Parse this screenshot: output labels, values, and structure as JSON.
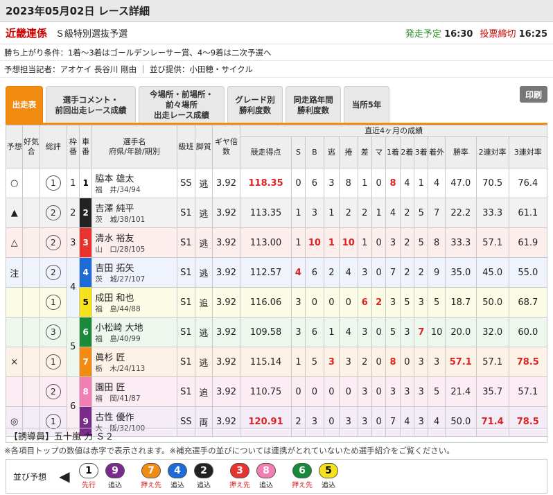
{
  "header": {
    "title": "2023年05月02日 レース詳細"
  },
  "race": {
    "name": "近畿連係",
    "sub": "Ｓ級特別選抜予選",
    "start_label": "発走予定",
    "start_time": "16:30",
    "close_label": "投票締切",
    "close_time": "16:25"
  },
  "info": {
    "condition": "勝ち上がり条件：1着～3着はゴールデンレーサー賞、4～9着は二次予選へ",
    "reporter": "予想担当記者：アオケイ 長谷川 剛由 ｜ 並び提供：小田穂・サイクル"
  },
  "tabs": [
    {
      "label": "出走表"
    },
    {
      "label": "選手コメント・\n前回出走レース成績"
    },
    {
      "label": "今場所・前場所・\n前々場所\n出走レース成績"
    },
    {
      "label": "グレード別\n勝利度数"
    },
    {
      "label": "同走路年間\n勝利度数"
    },
    {
      "label": "当所5年"
    }
  ],
  "print_label": "印刷",
  "table": {
    "group_header": "直近4ヶ月の成績",
    "columns": [
      "予想",
      "好気合",
      "総評",
      "枠番",
      "車番",
      "選手名\n府県/年齢/期別",
      "級班",
      "脚質",
      "ギヤ倍数",
      "競走得点",
      "S",
      "B",
      "逃",
      "捲",
      "差",
      "マ",
      "1着",
      "2着",
      "3着",
      "着外",
      "勝率",
      "2連対率",
      "3連対率"
    ],
    "rows": [
      {
        "mark": "○",
        "hyo": "1",
        "waku": "1",
        "car": "1",
        "name": "脇本 雄太",
        "profile": "福　井/34/94",
        "cls": "SS",
        "style": "逃",
        "gear": "3.92",
        "score": "118.35",
        "s": "0",
        "b": "6",
        "nige": "3",
        "makuri": "8",
        "sashi": "1",
        "ma": "0",
        "c1": "8",
        "c2": "4",
        "c3": "1",
        "out": "4",
        "win": "47.0",
        "ren2": "70.5",
        "ren3": "76.4"
      },
      {
        "mark": "▲",
        "hyo": "2",
        "waku": "2",
        "car": "2",
        "name": "吉澤 純平",
        "profile": "茨　城/38/101",
        "cls": "S1",
        "style": "逃",
        "gear": "3.92",
        "score": "113.35",
        "s": "1",
        "b": "3",
        "nige": "1",
        "makuri": "2",
        "sashi": "2",
        "ma": "1",
        "c1": "4",
        "c2": "2",
        "c3": "5",
        "out": "7",
        "win": "22.2",
        "ren2": "33.3",
        "ren3": "61.1"
      },
      {
        "mark": "△",
        "hyo": "2",
        "waku": "3",
        "car": "3",
        "name": "清水 裕友",
        "profile": "山　口/28/105",
        "cls": "S1",
        "style": "逃",
        "gear": "3.92",
        "score": "113.00",
        "s": "1",
        "b": "10",
        "nige": "1",
        "makuri": "10",
        "sashi": "1",
        "ma": "0",
        "c1": "3",
        "c2": "2",
        "c3": "5",
        "out": "8",
        "win": "33.3",
        "ren2": "57.1",
        "ren3": "61.9"
      },
      {
        "mark": "注",
        "hyo": "2",
        "waku": "4",
        "car": "4",
        "name": "吉田 拓矢",
        "profile": "茨　城/27/107",
        "cls": "S1",
        "style": "逃",
        "gear": "3.92",
        "score": "112.57",
        "s": "4",
        "b": "6",
        "nige": "2",
        "makuri": "4",
        "sashi": "3",
        "ma": "0",
        "c1": "7",
        "c2": "2",
        "c3": "2",
        "out": "9",
        "win": "35.0",
        "ren2": "45.0",
        "ren3": "55.0"
      },
      {
        "mark": "",
        "hyo": "1",
        "waku": "",
        "car": "5",
        "name": "成田 和也",
        "profile": "福　島/44/88",
        "cls": "S1",
        "style": "追",
        "gear": "3.92",
        "score": "116.06",
        "s": "3",
        "b": "0",
        "nige": "0",
        "makuri": "0",
        "sashi": "6",
        "ma": "2",
        "c1": "3",
        "c2": "5",
        "c3": "3",
        "out": "5",
        "win": "18.7",
        "ren2": "50.0",
        "ren3": "68.7"
      },
      {
        "mark": "",
        "hyo": "3",
        "waku": "5",
        "car": "6",
        "name": "小松崎 大地",
        "profile": "福　島/40/99",
        "cls": "S1",
        "style": "逃",
        "gear": "3.92",
        "score": "109.58",
        "s": "3",
        "b": "6",
        "nige": "1",
        "makuri": "4",
        "sashi": "3",
        "ma": "0",
        "c1": "5",
        "c2": "3",
        "c3": "7",
        "out": "10",
        "win": "20.0",
        "ren2": "32.0",
        "ren3": "60.0"
      },
      {
        "mark": "×",
        "hyo": "1",
        "waku": "",
        "car": "7",
        "name": "眞杉 匠",
        "profile": "栃　木/24/113",
        "cls": "S1",
        "style": "逃",
        "gear": "3.92",
        "score": "115.14",
        "s": "1",
        "b": "5",
        "nige": "3",
        "makuri": "3",
        "sashi": "2",
        "ma": "0",
        "c1": "8",
        "c2": "0",
        "c3": "3",
        "out": "3",
        "win": "57.1",
        "ren2": "57.1",
        "ren3": "78.5"
      },
      {
        "mark": "",
        "hyo": "2",
        "waku": "6",
        "car": "8",
        "name": "園田 匠",
        "profile": "福　岡/41/87",
        "cls": "S1",
        "style": "追",
        "gear": "3.92",
        "score": "110.75",
        "s": "0",
        "b": "0",
        "nige": "0",
        "makuri": "0",
        "sashi": "3",
        "ma": "0",
        "c1": "3",
        "c2": "3",
        "c3": "3",
        "out": "5",
        "win": "21.4",
        "ren2": "35.7",
        "ren3": "57.1"
      },
      {
        "mark": "◎",
        "hyo": "1",
        "waku": "",
        "car": "9",
        "name": "古性 優作",
        "profile": "大　阪/32/100",
        "cls": "SS",
        "style": "両",
        "gear": "3.92",
        "score": "120.91",
        "s": "2",
        "b": "3",
        "nige": "0",
        "makuri": "3",
        "sashi": "3",
        "ma": "0",
        "c1": "7",
        "c2": "4",
        "c3": "3",
        "out": "4",
        "win": "50.0",
        "ren2": "71.4",
        "ren3": "78.5"
      }
    ]
  },
  "guide": "【誘導員】五十嵐 力 Ｓ２",
  "note": "※各項目トップの数値は赤字で表示されます。※補充選手の並びについては連携がとれていないため選手紹介をご覧ください。",
  "nara": {
    "label": "並び予想",
    "groups": [
      [
        {
          "num": "1",
          "tag": "先行"
        },
        {
          "num": "9",
          "tag": "追込"
        }
      ],
      [
        {
          "num": "7",
          "tag": "押え先"
        },
        {
          "num": "4",
          "tag": "追込"
        },
        {
          "num": "2",
          "tag": "追込"
        }
      ],
      [
        {
          "num": "3",
          "tag": "押え先"
        },
        {
          "num": "8",
          "tag": "追込"
        }
      ],
      [
        {
          "num": "6",
          "tag": "押え先"
        },
        {
          "num": "5",
          "tag": "追込"
        }
      ]
    ]
  },
  "colors": {
    "car": {
      "1": [
        "#ffffff",
        "#000"
      ],
      "2": [
        "#222222",
        "#fff"
      ],
      "3": [
        "#e8332e",
        "#fff"
      ],
      "4": [
        "#1d6bd6",
        "#fff"
      ],
      "5": [
        "#f5e21a",
        "#000"
      ],
      "6": [
        "#1a8a3a",
        "#fff"
      ],
      "7": [
        "#f18b12",
        "#fff"
      ],
      "8": [
        "#f27fb3",
        "#fff"
      ],
      "9": [
        "#7a2a8a",
        "#fff"
      ]
    },
    "row_bg": {
      "1": "#ffffff",
      "2": "#f2f2f2",
      "3": "#fdeeee",
      "4": "#eef3fc",
      "5": "#fcfbe6",
      "6": "#eef7ee",
      "7": "#fdf2e6",
      "8": "#fcecf4",
      "9": "#f4ecf7"
    }
  }
}
